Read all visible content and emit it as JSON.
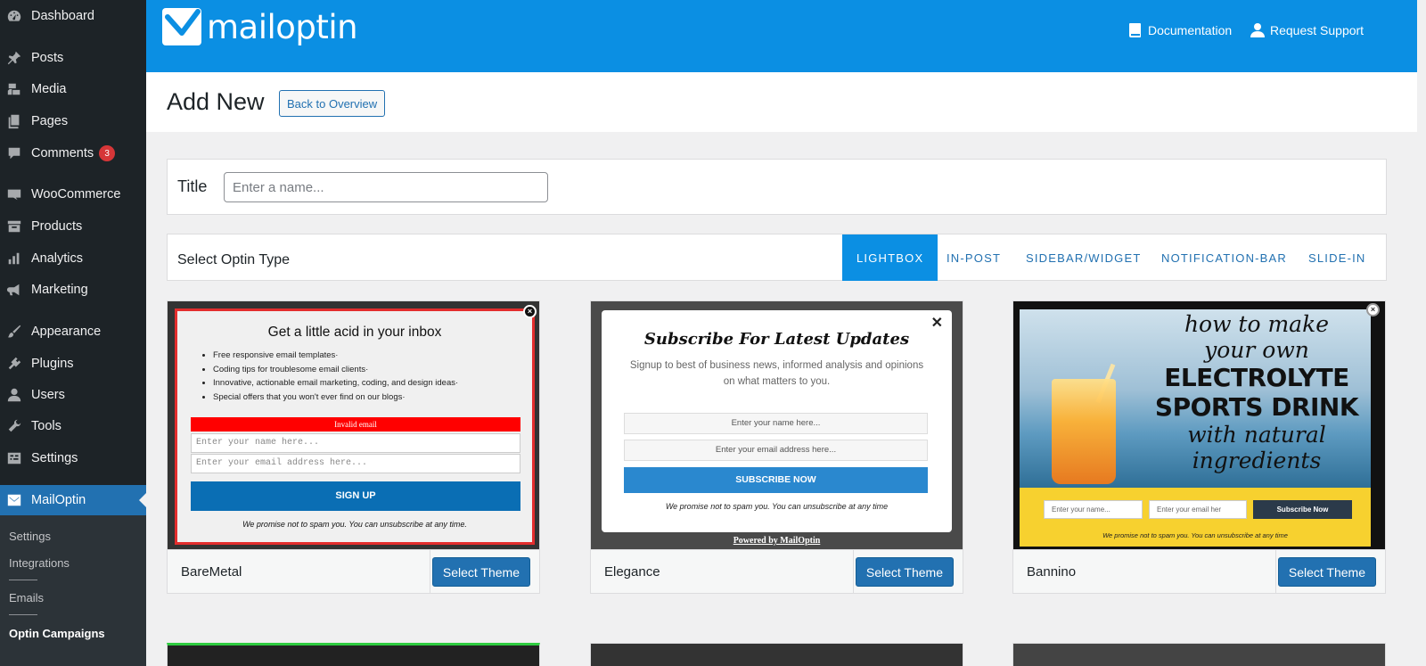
{
  "sidebar": {
    "items": [
      {
        "label": "Dashboard",
        "icon": "dashboard-icon"
      },
      {
        "label": "Posts",
        "icon": "pin-icon"
      },
      {
        "label": "Media",
        "icon": "media-icon"
      },
      {
        "label": "Pages",
        "icon": "pages-icon"
      },
      {
        "label": "Comments",
        "icon": "comment-icon",
        "badge": "3"
      },
      {
        "label": "WooCommerce",
        "icon": "woocommerce-icon"
      },
      {
        "label": "Products",
        "icon": "archive-icon"
      },
      {
        "label": "Analytics",
        "icon": "bar-chart-icon"
      },
      {
        "label": "Marketing",
        "icon": "megaphone-icon"
      },
      {
        "label": "Appearance",
        "icon": "brush-icon"
      },
      {
        "label": "Plugins",
        "icon": "plugin-icon"
      },
      {
        "label": "Users",
        "icon": "user-icon"
      },
      {
        "label": "Tools",
        "icon": "wrench-icon"
      },
      {
        "label": "Settings",
        "icon": "settings-icon"
      },
      {
        "label": "MailOptin",
        "icon": "mail-icon"
      }
    ],
    "submenu": [
      "Settings",
      "Integrations",
      "Emails",
      "Optin Campaigns"
    ]
  },
  "header": {
    "brand": "mailoptin",
    "documentation": "Documentation",
    "support": "Request Support"
  },
  "page": {
    "title": "Add New",
    "back_button": "Back to Overview"
  },
  "title_panel": {
    "label": "Title",
    "placeholder": "Enter a name..."
  },
  "type_panel": {
    "label": "Select Optin Type",
    "tabs": [
      "LIGHTBOX",
      "IN-POST",
      "SIDEBAR/WIDGET",
      "NOTIFICATION-BAR",
      "SLIDE-IN"
    ],
    "active": "LIGHTBOX"
  },
  "themes": [
    {
      "name": "BareMetal",
      "button": "Select Theme",
      "preview": {
        "headline": "Get a little acid in your inbox",
        "bullets": [
          "Free responsive email templates·",
          "Coding tips for troublesome email clients·",
          "Innovative, actionable email marketing, coding, and design ideas·",
          "Special offers that you won't ever find on our blogs·"
        ],
        "error": "Invalid email",
        "name_placeholder": "Enter your name here...",
        "email_placeholder": "Enter your email address here...",
        "cta": "SIGN UP",
        "note": "We promise not to spam you. You can unsubscribe at any time."
      }
    },
    {
      "name": "Elegance",
      "button": "Select Theme",
      "preview": {
        "headline": "Subscribe For Latest Updates",
        "description": "Signup to best of business news, informed analysis and opinions on what matters to you.",
        "name_placeholder": "Enter your name here...",
        "email_placeholder": "Enter your email address here...",
        "cta": "SUBSCRIBE NOW",
        "note": "We promise not to spam you. You can unsubscribe at any time",
        "powered": "Powered by MailOptin"
      }
    },
    {
      "name": "Bannino",
      "button": "Select Theme",
      "preview": {
        "line1": "how to make",
        "line2": "your own",
        "line3": "ELECTROLYTE",
        "line4": "SPORTS DRINK",
        "line5": "with natural",
        "line6": "ingredients",
        "name_placeholder": "Enter your name...",
        "email_placeholder": "Enter your email her",
        "cta": "Subscribe Now",
        "note": "We promise not to spam you. You can unsubscribe at any time"
      }
    }
  ],
  "colors": {
    "sidebar": "#1d2327",
    "brand_bar": "#0b8fe3",
    "primary_button": "#2271b1",
    "badge": "#d63638"
  }
}
